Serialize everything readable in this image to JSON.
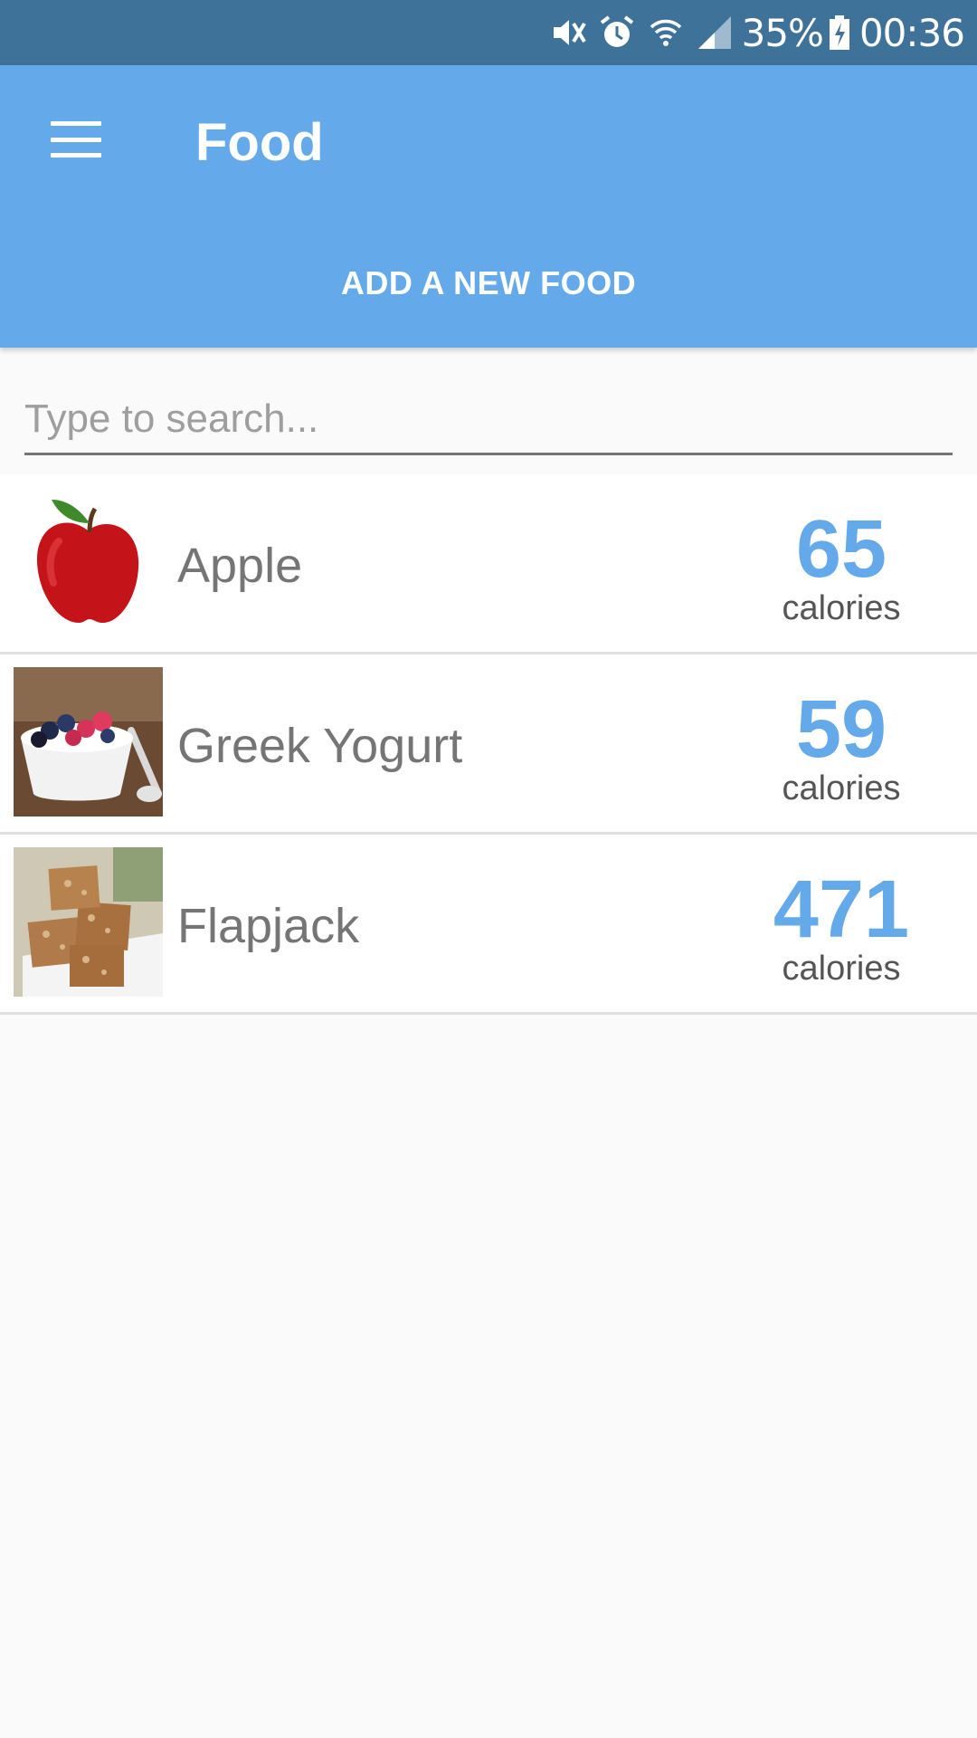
{
  "status_bar": {
    "battery": "35%",
    "time": "00:36",
    "icons": [
      "mute-icon",
      "alarm-icon",
      "wifi-icon",
      "signal-icon",
      "battery-charging-icon"
    ]
  },
  "app_bar": {
    "title": "Food",
    "menu_icon": "hamburger-menu-icon",
    "action_label": "ADD A NEW FOOD",
    "color": "#64a9ea"
  },
  "search": {
    "placeholder": "Type to search...",
    "value": ""
  },
  "foods": [
    {
      "name": "Apple",
      "calories": "65",
      "unit": "calories",
      "image": "apple-image"
    },
    {
      "name": "Greek Yogurt",
      "calories": "59",
      "unit": "calories",
      "image": "greek-yogurt-image"
    },
    {
      "name": "Flapjack",
      "calories": "471",
      "unit": "calories",
      "image": "flapjack-image"
    }
  ]
}
